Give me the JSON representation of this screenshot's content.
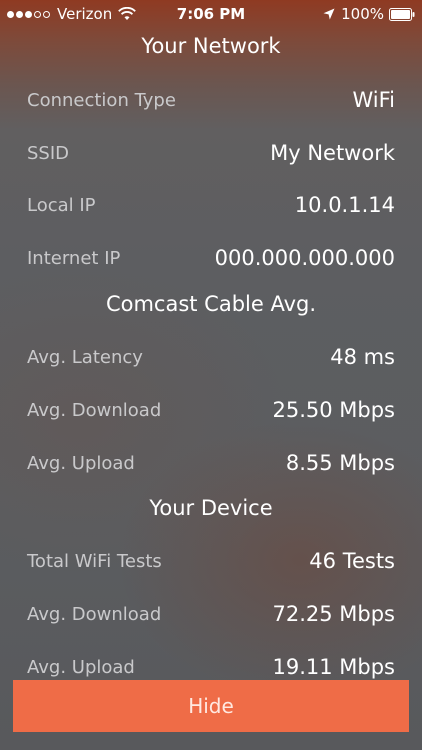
{
  "status_bar": {
    "carrier": "Verizon",
    "signal_bars_filled": 3,
    "signal_bars_total": 5,
    "time": "7:06 PM",
    "battery": "100%",
    "icons": [
      "wifi-icon",
      "location-arrow-icon",
      "battery-icon"
    ]
  },
  "network": {
    "title": "Your Network",
    "rows": [
      {
        "label": "Connection Type",
        "value": "WiFi"
      },
      {
        "label": "SSID",
        "value": "My Network"
      },
      {
        "label": "Local IP",
        "value": "10.0.1.14"
      },
      {
        "label": "Internet IP",
        "value": "000.000.000.000"
      }
    ]
  },
  "comcast": {
    "title": "Comcast Cable Avg.",
    "rows": [
      {
        "label": "Avg. Latency",
        "value": "48 ms"
      },
      {
        "label": "Avg. Download",
        "value": "25.50 Mbps"
      },
      {
        "label": "Avg. Upload",
        "value": "8.55 Mbps"
      }
    ]
  },
  "device": {
    "title": "Your Device",
    "rows": [
      {
        "label": "Total WiFi Tests",
        "value": "46 Tests"
      },
      {
        "label": "Avg. Download",
        "value": "72.25 Mbps"
      },
      {
        "label": "Avg. Upload",
        "value": "19.11 Mbps"
      }
    ]
  },
  "hide_button": {
    "label": "Hide"
  },
  "colors": {
    "accent": "#ef6c47",
    "header_tint": "#8f3a22",
    "background": "#5c5d60",
    "label_text": "#c9c9cb",
    "value_text": "#ffffff"
  }
}
